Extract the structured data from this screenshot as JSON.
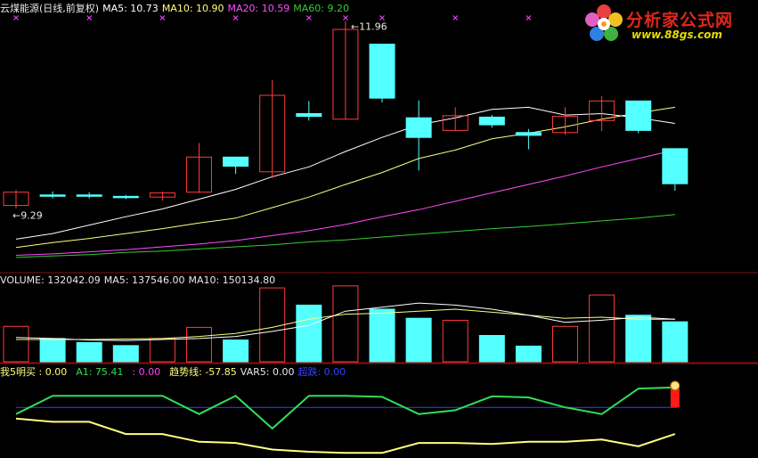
{
  "colors": {
    "up": "#ff3c3c",
    "down": "#54ffff",
    "ma5": "#ffffff",
    "ma10": "#ffff80",
    "ma20": "#ff4dff",
    "ma60": "#33cc33",
    "separator": "#8a1010",
    "green_line": "#33dd55",
    "yellow_line": "#ffff80",
    "blue_line": "#3344ff",
    "magenta_x": "#ff44ff"
  },
  "price_header": {
    "title": "云煤能源(日线,前复权)",
    "ma5": "MA5: 10.73",
    "ma10": "MA10: 10.90",
    "ma20": "MA20: 10.59",
    "ma60": "MA60: 9.20"
  },
  "volume_header": {
    "volume": "VOLUME: 132042.09",
    "ma5": "MA5: 137546.00",
    "ma10": "MA10: 150134.80"
  },
  "indicator_header": {
    "wo5": "我5明买 : 0.00",
    "a1": "A1: 75.41",
    "blank": ": 0.00",
    "trend": "趋势线: -57.85",
    "var5": "VAR5: 0.00",
    "chaodie": "超跌: 0.00"
  },
  "logo": {
    "name": "分析家公式网",
    "url": "www.88gs.com"
  },
  "chart_data": [
    {
      "type": "candlestick",
      "title": "云煤能源(日线,前复权)",
      "annotations": [
        {
          "text": "9.29",
          "candle": 0,
          "at": "low"
        },
        {
          "text": "11.96",
          "candle": 9,
          "at": "high"
        }
      ],
      "candles": [
        {
          "o": 9.33,
          "h": 9.55,
          "l": 9.29,
          "c": 9.52
        },
        {
          "o": 9.48,
          "h": 9.53,
          "l": 9.43,
          "c": 9.47
        },
        {
          "o": 9.48,
          "h": 9.52,
          "l": 9.43,
          "c": 9.47
        },
        {
          "o": 9.46,
          "h": 9.48,
          "l": 9.42,
          "c": 9.45
        },
        {
          "o": 9.45,
          "h": 9.53,
          "l": 9.4,
          "c": 9.51
        },
        {
          "o": 9.52,
          "h": 10.22,
          "l": 9.51,
          "c": 10.02
        },
        {
          "o": 10.02,
          "h": 10.02,
          "l": 9.78,
          "c": 9.89
        },
        {
          "o": 9.81,
          "h": 11.12,
          "l": 9.72,
          "c": 10.9
        },
        {
          "o": 10.64,
          "h": 10.82,
          "l": 10.54,
          "c": 10.6
        },
        {
          "o": 10.56,
          "h": 11.96,
          "l": 10.56,
          "c": 11.84
        },
        {
          "o": 11.63,
          "h": 11.63,
          "l": 10.8,
          "c": 10.86
        },
        {
          "o": 10.58,
          "h": 10.83,
          "l": 9.83,
          "c": 10.3
        },
        {
          "o": 10.4,
          "h": 10.73,
          "l": 10.4,
          "c": 10.61
        },
        {
          "o": 10.59,
          "h": 10.62,
          "l": 10.44,
          "c": 10.48
        },
        {
          "o": 10.37,
          "h": 10.42,
          "l": 10.13,
          "c": 10.33
        },
        {
          "o": 10.37,
          "h": 10.73,
          "l": 10.34,
          "c": 10.6
        },
        {
          "o": 10.54,
          "h": 10.89,
          "l": 10.39,
          "c": 10.82
        },
        {
          "o": 10.82,
          "h": 10.82,
          "l": 10.36,
          "c": 10.4
        },
        {
          "o": 10.14,
          "h": 10.14,
          "l": 9.54,
          "c": 9.64
        }
      ],
      "ma5": [
        8.85,
        8.93,
        9.05,
        9.17,
        9.28,
        9.42,
        9.56,
        9.74,
        9.88,
        10.1,
        10.3,
        10.48,
        10.58,
        10.7,
        10.73,
        10.62,
        10.64,
        10.58,
        10.5
      ],
      "ma10": [
        8.73,
        8.8,
        8.86,
        8.93,
        9.0,
        9.08,
        9.15,
        9.3,
        9.45,
        9.63,
        9.8,
        10.0,
        10.12,
        10.28,
        10.36,
        10.45,
        10.56,
        10.65,
        10.73
      ],
      "ma20": [
        8.62,
        8.64,
        8.67,
        8.7,
        8.74,
        8.78,
        8.83,
        8.9,
        8.97,
        9.06,
        9.17,
        9.27,
        9.39,
        9.51,
        9.63,
        9.75,
        9.88,
        10.0,
        10.12
      ],
      "ma60": [
        8.59,
        8.61,
        8.63,
        8.66,
        8.68,
        8.71,
        8.74,
        8.77,
        8.81,
        8.84,
        8.88,
        8.92,
        8.96,
        9.0,
        9.03,
        9.07,
        9.11,
        9.15,
        9.2
      ]
    },
    {
      "type": "bar",
      "title": "VOLUME",
      "values": [
        70000,
        46000,
        38000,
        32000,
        46000,
        68000,
        43000,
        146000,
        112000,
        150000,
        104000,
        86000,
        82000,
        52000,
        31000,
        70000,
        132000,
        92000,
        79000
      ],
      "ma5": [
        48000,
        46000,
        43000,
        42000,
        44000,
        46000,
        50000,
        60000,
        72000,
        100000,
        108000,
        116000,
        112000,
        104000,
        92000,
        78000,
        82000,
        88000,
        84000
      ],
      "ma10": [
        44000,
        44000,
        44000,
        45000,
        46000,
        50000,
        56000,
        68000,
        84000,
        94000,
        96000,
        100000,
        104000,
        98000,
        92000,
        86000,
        88000,
        84000,
        84000
      ]
    },
    {
      "type": "line",
      "title": "我5明买",
      "series": [
        {
          "name": "A1",
          "values": [
            46,
            79,
            79,
            79,
            79,
            46,
            79,
            20,
            79,
            79,
            77,
            46,
            53,
            78,
            76,
            58,
            46,
            92,
            94
          ]
        },
        {
          "name": "趋势线",
          "values": [
            38,
            32,
            32,
            10,
            10,
            -4,
            -6,
            -18,
            -22,
            -24,
            -24,
            -6,
            -6,
            -8,
            -4,
            -4,
            0,
            -12,
            10
          ]
        }
      ],
      "reference": 58,
      "signal_candle": 18
    }
  ]
}
